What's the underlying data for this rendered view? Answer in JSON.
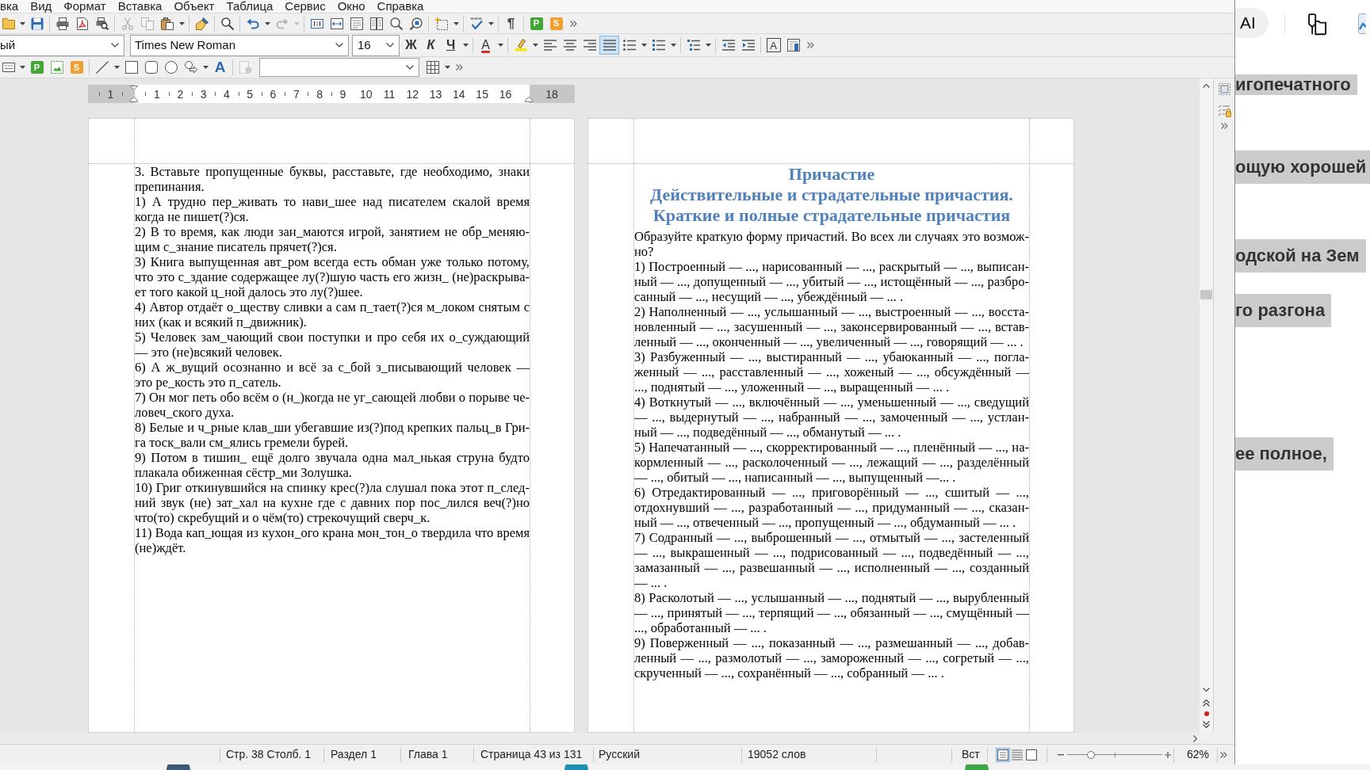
{
  "menu_bar": [
    "вка",
    "Вид",
    "Формат",
    "Вставка",
    "Объект",
    "Таблица",
    "Сервис",
    "Окно",
    "Справка"
  ],
  "standard_toolbar": [
    {
      "kind": "button",
      "disabled": false
    },
    {
      "kind": "caret",
      "disabled": false
    },
    {
      "kind": "button",
      "disabled": false
    },
    {
      "kind": "separator"
    },
    {
      "kind": "button",
      "disabled": false
    },
    {
      "kind": "button",
      "disabled": false
    },
    {
      "kind": "button",
      "disabled": false
    },
    {
      "kind": "separator"
    },
    {
      "kind": "button",
      "disabled": true
    },
    {
      "kind": "button",
      "disabled": true
    },
    {
      "kind": "button",
      "disabled": false
    },
    {
      "kind": "caret",
      "disabled": false
    },
    {
      "kind": "separator"
    },
    {
      "kind": "button",
      "disabled": false
    },
    {
      "kind": "separator"
    },
    {
      "kind": "button",
      "disabled": false
    },
    {
      "kind": "separator"
    },
    {
      "kind": "button",
      "disabled": false
    },
    {
      "kind": "caret",
      "disabled": false
    },
    {
      "kind": "button",
      "disabled": true
    },
    {
      "kind": "caret",
      "disabled": true
    },
    {
      "kind": "separator"
    },
    {
      "kind": "button",
      "disabled": false
    },
    {
      "kind": "button",
      "disabled": false
    },
    {
      "kind": "button",
      "disabled": false
    },
    {
      "kind": "button",
      "disabled": false
    },
    {
      "kind": "button",
      "disabled": false
    },
    {
      "kind": "button",
      "disabled": false
    },
    {
      "kind": "separator"
    },
    {
      "kind": "button",
      "disabled": false
    },
    {
      "kind": "caret",
      "disabled": false
    },
    {
      "kind": "separator"
    },
    {
      "kind": "button",
      "disabled": false
    },
    {
      "kind": "caret",
      "disabled": false
    },
    {
      "kind": "separator"
    },
    {
      "kind": "letter",
      "label": "¶",
      "disabled": false
    },
    {
      "kind": "separator"
    },
    {
      "kind": "letter",
      "label": "P",
      "disabled": false
    },
    {
      "kind": "letter",
      "label": "S",
      "disabled": false
    },
    {
      "kind": "button",
      "disabled": false
    }
  ],
  "formatting_toolbar": {
    "paragraph_style": "ый",
    "font_name": "Times New Roman",
    "font_size": "16",
    "buttons": [
      {
        "kind": "letter",
        "label": "Ж",
        "selected": false
      },
      {
        "kind": "letter",
        "label": "К",
        "selected": false
      },
      {
        "kind": "letter",
        "label": "Ч",
        "selected": false
      },
      {
        "kind": "caret"
      },
      {
        "kind": "separator"
      },
      {
        "kind": "letter",
        "label": "A",
        "selected": false
      },
      {
        "kind": "caret"
      },
      {
        "kind": "separator"
      },
      {
        "kind": "button",
        "selected": false
      },
      {
        "kind": "caret"
      },
      {
        "kind": "button",
        "selected": false
      },
      {
        "kind": "button",
        "selected": false
      },
      {
        "kind": "button",
        "selected": false
      },
      {
        "kind": "button",
        "selected": true
      },
      {
        "kind": "button",
        "selected": false
      },
      {
        "kind": "caret"
      },
      {
        "kind": "button",
        "selected": false
      },
      {
        "kind": "caret"
      },
      {
        "kind": "separator"
      },
      {
        "kind": "button",
        "selected": false
      },
      {
        "kind": "caret"
      },
      {
        "kind": "separator"
      },
      {
        "kind": "button",
        "selected": false
      },
      {
        "kind": "button",
        "selected": false
      },
      {
        "kind": "separator"
      },
      {
        "kind": "letter",
        "label": "A",
        "selected": false
      },
      {
        "kind": "button",
        "selected": false
      },
      {
        "kind": "button",
        "selected": false
      }
    ]
  },
  "drawing_toolbar": [
    {
      "kind": "button",
      "disabled": false
    },
    {
      "kind": "caret",
      "disabled": false
    },
    {
      "kind": "letter",
      "label": "P",
      "disabled": false
    },
    {
      "kind": "button",
      "disabled": false
    },
    {
      "kind": "letter",
      "label": "S",
      "disabled": false
    },
    {
      "kind": "separator"
    },
    {
      "kind": "button",
      "disabled": false
    },
    {
      "kind": "caret",
      "disabled": false
    },
    {
      "kind": "button",
      "disabled": false
    },
    {
      "kind": "button",
      "disabled": false
    },
    {
      "kind": "button",
      "disabled": false
    },
    {
      "kind": "button",
      "disabled": false
    },
    {
      "kind": "caret",
      "disabled": false
    },
    {
      "kind": "letter",
      "label": "A",
      "disabled": false
    },
    {
      "kind": "separator"
    },
    {
      "kind": "button",
      "disabled": true
    },
    {
      "kind": "combo",
      "disabled": false
    },
    {
      "kind": "button",
      "disabled": false
    },
    {
      "kind": "caret",
      "disabled": false
    },
    {
      "kind": "button",
      "disabled": false
    }
  ],
  "ruler": {
    "left_numbers": [
      "1"
    ],
    "numbers": [
      "1",
      "2",
      "3",
      "4",
      "5",
      "6",
      "7",
      "8",
      "9",
      "10",
      "11",
      "12",
      "13",
      "14",
      "15",
      "16"
    ],
    "right_numbers": [
      "18"
    ]
  },
  "document_pages": [
    {
      "paragraphs": [
        {
          "lines": [
            "3. Вставьте пропущенные буквы, расставьте, где необходимо, знаки",
            "препинания."
          ]
        },
        {
          "lines": [
            "1) А трудно пер_живать то нави_шее над писателем скалой время",
            "когда не пишет(?)ся."
          ]
        },
        {
          "lines": [
            "2) В то время, как люди зан_маются игрой, занятием не обр_меняю-",
            "щим с_знание писатель прячет(?)ся."
          ]
        },
        {
          "lines": [
            "3) Книга выпущенная авт_ром всегда есть обман уже только потому,",
            "что это с_здание содержащее лу(?)шую часть его жизн_ (не)раскрыва-",
            "ет того какой ц_ной далось это лу(?)шее."
          ]
        },
        {
          "lines": [
            "4) Автор отдаёт о_ществу сливки а сам п_тает(?)ся м_локом снятым с",
            "них (как и всякий п_движник)."
          ]
        },
        {
          "lines": [
            "5) Человек зам_чающий свои поступки и про себя их о_суждающий",
            "— это (не)всякий человек."
          ]
        },
        {
          "lines": [
            "6) А ж_вущий осознанно и всё за с_бой з_писывающий человек —",
            "это ре_кость это п_сатель."
          ]
        },
        {
          "lines": [
            "7) Он мог петь обо всём о (н_)когда не уг_сающей любви о порыве че-",
            "ловеч_ского духа."
          ]
        },
        {
          "lines": [
            "8) Белые и ч_рные клав_ши убегавшие из(?)под крепких пальц_в Гри-",
            "га тоск_вали см_ялись гремели бурей."
          ]
        },
        {
          "lines": [
            "9) Потом в тишин_ ещё долго звучала одна мал_нькая струна будто",
            "плакала обиженная сёстр_ми Золушка."
          ]
        },
        {
          "lines": [
            "10) Григ откинувшийся на спинку крес(?)ла слушал пока этот п_след-",
            "ний звук (не) зат_хал на кухне где с давних пор пос_лился веч(?)но",
            "что(то) скребущий и о чём(то) стрекочущий сверч_к."
          ]
        },
        {
          "lines": [
            "11) Вода кап_ющая из кухон_ого крана мон_тон_о твердила что время",
            "(не)ждёт."
          ]
        }
      ]
    },
    {
      "heading_lines": [
        "Причастие",
        "Действительные и страдательные причастия.",
        "Краткие и полные страдательные причастия"
      ],
      "paragraphs": [
        {
          "lines": [
            "Образуйте краткую форму причастий. Во всех ли случаях это возмож-",
            "но?"
          ]
        },
        {
          "lines": [
            "1) Построенный — ..., нарисованный — ..., раскрытый — ..., выписан-",
            "ный — ..., допущенный — ..., убитый — ..., истощённый — ..., разбро-",
            "санный — ..., несущий — ..., убеждённый — ... ."
          ]
        },
        {
          "lines": [
            "2) Наполненный — ..., услышанный — ..., выстроенный — ..., восста-",
            "новленный — ..., засушенный — ..., законсервированный — ..., встав-",
            "ленный — ..., оконченный — ..., увеличенный — ..., говорящий — ... ."
          ]
        },
        {
          "lines": [
            "3) Разбуженный — ..., выстиранный — ..., убаюканный — ..., погла-",
            "женный — ..., расставленный — ..., хоженый — ..., обсуждённый —",
            "..., поднятый — ..., уложенный — ..., выращенный — ... ."
          ]
        },
        {
          "lines": [
            "4) Воткнутый — ..., включённый — ..., уменьшенный — ..., сведущий",
            "— ..., выдернутый — ..., набранный — ..., замоченный — ..., устлан-",
            "ный — ..., подведённый — ..., обманутый — ... ."
          ]
        },
        {
          "lines": [
            "5) Напечатанный — ..., скорректированный — ..., пленённый — ..., на-",
            "кормленный — ..., расколоченный — ..., лежащий — ..., разделённый",
            "— ..., обитый — ..., написанный — ..., выпущенный —... ."
          ]
        },
        {
          "lines": [
            "6) Отредактированный — ..., приговорённый — ..., сшитый — ...,",
            "отдохнувший — ..., разработанный — ..., придуманный — ..., сказан-",
            "ный — ..., отвеченный — ..., пропущенный — ..., обдуманный — ... ."
          ]
        },
        {
          "lines": [
            "7) Содранный — ..., выброшенный — ..., отмытый — ..., застеленный",
            "— ..., выкрашенный — ..., подрисованный — ..., подведённый — ...,",
            "замазанный — ..., развешанный — ..., исполненный — ..., созданный",
            "— ... ."
          ]
        },
        {
          "lines": [
            "8) Расколотый — ..., услышанный — ..., поднятый — ..., вырубленный",
            "— ..., принятый — ..., терпящий — ..., обязанный — ..., смущённый —",
            "..., обработанный — ... ."
          ]
        },
        {
          "lines": [
            "9) Поверженный — ..., показанный — ..., размешанный — ..., добав-",
            "ленный — ..., размолотый — ..., замороженный — ..., согретый — ...,",
            "скрученный — ..., сохранённый — ..., собранный — ... ."
          ]
        }
      ]
    }
  ],
  "status_bar": {
    "cursor_position": "Стр. 38 Столб. 1",
    "section": "Раздел 1",
    "chapter": "Глава 1",
    "page_count": "Страница 43 из 131",
    "language": "Русский",
    "word_count": "19052 слов",
    "insert_mode": "Вст",
    "view_modes": [
      {
        "selected": true
      },
      {
        "selected": false
      },
      {
        "selected": false
      }
    ],
    "zoom_slider": {
      "level": 0.25
    },
    "zoom_percent": "62%"
  },
  "side_window": {
    "ai_button": "AI",
    "text_lines": [
      "игопечатного",
      "ощую хорошей",
      "одской на Зем",
      "го разгона",
      "ее полное,"
    ]
  }
}
